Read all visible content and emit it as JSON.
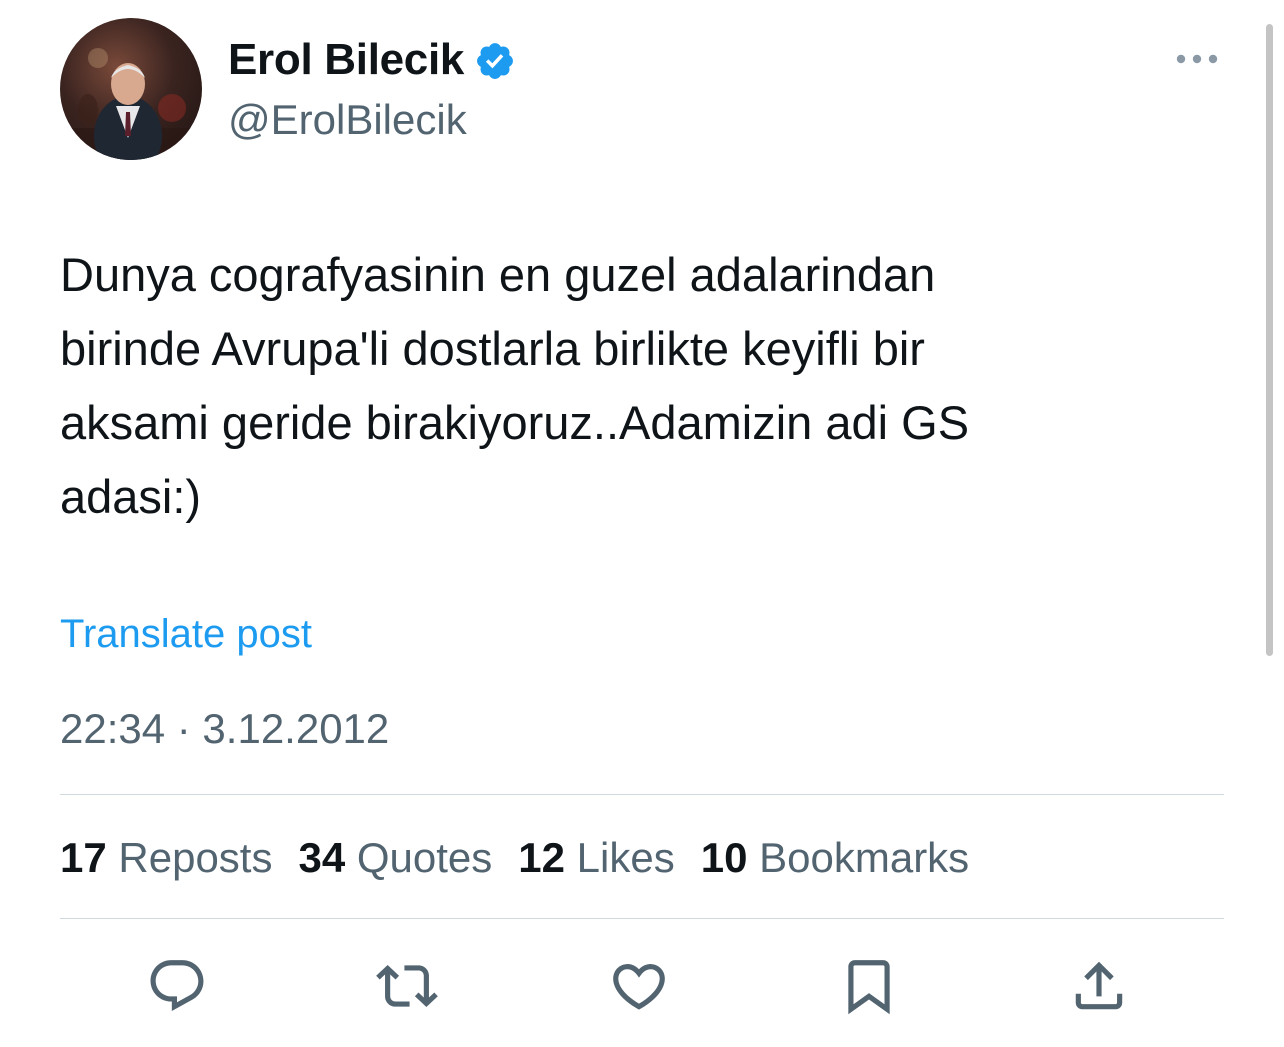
{
  "author": {
    "name": "Erol Bilecik",
    "handle": "@ErolBilecik",
    "verified_color": "#1d9bf0"
  },
  "tweet": {
    "text": "Dunya cografyasinin en guzel adalarindan\nbirinde Avrupa'li dostlarla birlikte keyifli bir\naksami geride birakiyoruz..Adamizin adi GS\nadasi:)",
    "translate_label": "Translate post",
    "timestamp": "22:34 · 3.12.2012"
  },
  "stats": [
    {
      "count": "17",
      "label": "Reposts"
    },
    {
      "count": "34",
      "label": "Quotes"
    },
    {
      "count": "12",
      "label": "Likes"
    },
    {
      "count": "10",
      "label": "Bookmarks"
    }
  ],
  "actions": [
    {
      "icon": "reply-icon"
    },
    {
      "icon": "repost-icon"
    },
    {
      "icon": "like-icon"
    },
    {
      "icon": "bookmark-icon"
    },
    {
      "icon": "share-icon"
    }
  ],
  "colors": {
    "text": "#0f1419",
    "secondary": "#536471",
    "link": "#1d9bf0",
    "divider": "#cfd9de"
  }
}
